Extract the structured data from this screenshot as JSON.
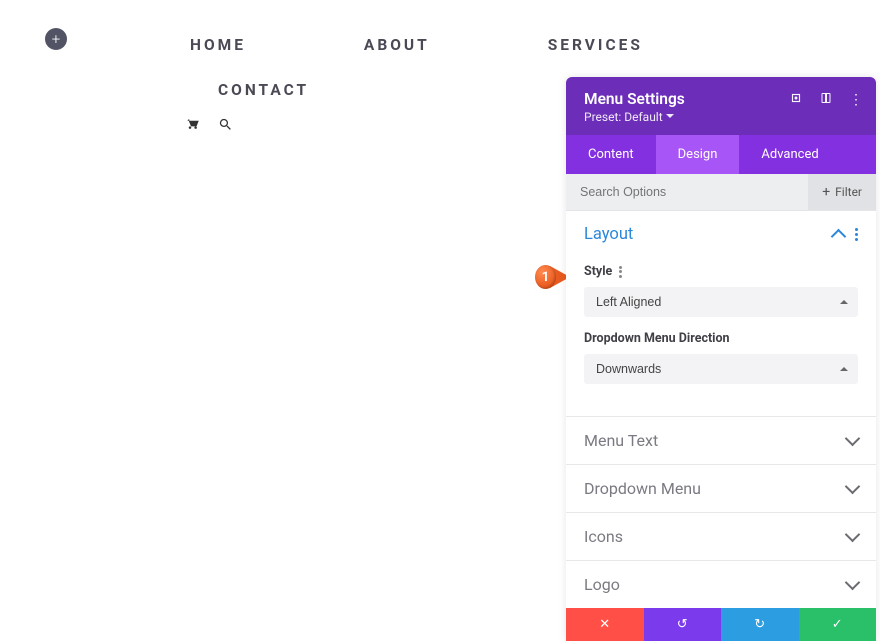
{
  "nav": {
    "home": "HOME",
    "about": "ABOUT",
    "services": "SERVICES",
    "contact": "CONTACT"
  },
  "panel": {
    "title": "Menu Settings",
    "preset": "Preset: Default",
    "tabs": {
      "content": "Content",
      "design": "Design",
      "advanced": "Advanced"
    },
    "search_placeholder": "Search Options",
    "filter_label": "Filter"
  },
  "sections": {
    "layout": {
      "title": "Layout",
      "style_label": "Style",
      "style_value": "Left Aligned",
      "dropdown_label": "Dropdown Menu Direction",
      "dropdown_value": "Downwards"
    },
    "menu_text": "Menu Text",
    "dropdown_menu": "Dropdown Menu",
    "icons": "Icons",
    "logo": "Logo"
  },
  "callout": {
    "num": "1"
  }
}
